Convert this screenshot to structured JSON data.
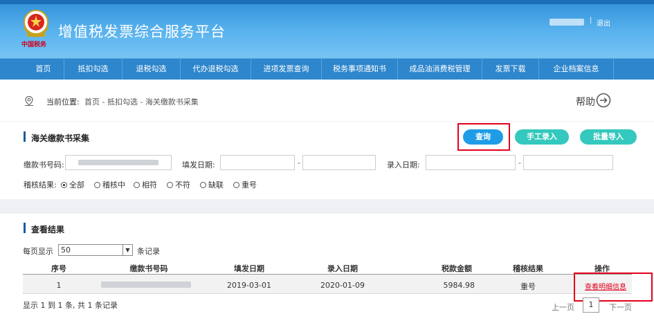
{
  "header": {
    "app_title": "增值税发票综合服务平台",
    "brand_sub": "中国税务",
    "user_separator": "|",
    "logout_label": "退出"
  },
  "nav": {
    "items": [
      {
        "label": "首页"
      },
      {
        "label": "抵扣勾选"
      },
      {
        "label": "退税勾选"
      },
      {
        "label": "代办退税勾选"
      },
      {
        "label": "进项发票查询"
      },
      {
        "label": "税务事项通知书"
      },
      {
        "label": "成品油消费税管理"
      },
      {
        "label": "发票下载"
      },
      {
        "label": "企业档案信息"
      }
    ]
  },
  "breadcrumb": {
    "label": "当前位置:",
    "path": "首页 - 抵扣勾选 - 海关缴款书采集",
    "help_label": "帮助"
  },
  "search_panel": {
    "title": "海关缴款书采集",
    "query_label": "查询",
    "manual_entry_label": "手工录入",
    "batch_import_label": "批量导入",
    "field_doc_no": "缴款书号码:",
    "field_issue_date": "填发日期:",
    "field_entry_date": "录入日期:",
    "dash": "-",
    "audit_result_label": "稽核结果:",
    "audit_options": [
      {
        "label": "全部",
        "selected": true
      },
      {
        "label": "稽核中",
        "selected": false
      },
      {
        "label": "相符",
        "selected": false
      },
      {
        "label": "不符",
        "selected": false
      },
      {
        "label": "缺联",
        "selected": false
      },
      {
        "label": "重号",
        "selected": false
      }
    ]
  },
  "results": {
    "title": "查看结果",
    "per_page_label": "每页显示",
    "per_page_value": "50",
    "per_page_suffix": "条记录",
    "columns": [
      "序号",
      "缴款书号码",
      "填发日期",
      "录入日期",
      "税款金额",
      "稽核结果",
      "操作"
    ],
    "rows": [
      {
        "index": "1",
        "issue_date": "2019-03-01",
        "entry_date": "2020-01-09",
        "tax_amount": "5984.98",
        "audit_result": "重号",
        "action": "查看明细信息"
      }
    ],
    "footer_info": "显示 1 到 1 条, 共 1 条记录",
    "prev_page": "上一页",
    "current_page": "1",
    "next_page": "下一页"
  },
  "colors": {
    "header_blue": "#2f8fd8",
    "nav_blue": "#2e86cc",
    "query_button": "#1e9de6",
    "teal_button": "#35c8be",
    "highlight_red": "#e3001b"
  }
}
